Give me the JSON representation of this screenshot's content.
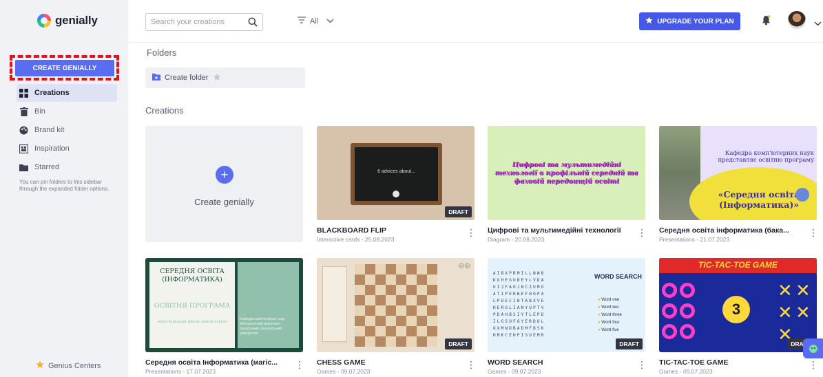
{
  "brand": {
    "name": "genially"
  },
  "sidebar": {
    "create_label": "CREATE GENIALLY",
    "items": [
      {
        "label": "Creations",
        "icon": "grid-icon"
      },
      {
        "label": "Bin",
        "icon": "trash-icon"
      },
      {
        "label": "Brand kit",
        "icon": "palette-icon"
      },
      {
        "label": "Inspiration",
        "icon": "inspiration-icon"
      },
      {
        "label": "Starred",
        "icon": "folder-icon"
      }
    ],
    "note": "You can pin folders to this sidebar through the expanded folder options.",
    "footer_label": "Genius Centers"
  },
  "topbar": {
    "search_placeholder": "Search your creations",
    "filter_label": "All",
    "upgrade_label": "UPGRADE YOUR PLAN"
  },
  "main": {
    "folders_title": "Folders",
    "create_folder_label": "Create folder",
    "creations_title": "Creations",
    "create_card_label": "Create genially",
    "draft_label": "DRAFT",
    "cards": [
      {
        "title": "BLACKBOARD FLIP",
        "meta": "Interactive cards - 25.08.2023",
        "thumb_text": "6 advices about...",
        "draft": true
      },
      {
        "title": "Цифрові та мультимедійні технології",
        "meta": "Diagram - 20.08.2023",
        "thumb_text": "Цифрові та мультимедійні технології в профільній середній та фаховій передвищій освіті",
        "draft": false
      },
      {
        "title": "Середня освіта інформатика (бака...",
        "meta": "Presentations - 21.07.2023",
        "thumb_text_1": "Кафедра комп'ютерних наук представляє освітню програму",
        "thumb_text_2": "«Середня освіта (Інформатика)»",
        "draft": false
      },
      {
        "title": "Середня освіта Інформатика (магіс...",
        "meta": "Presentations - 17.07.2023",
        "thumb_text_1": "СЕРЕДНЯ ОСВІТА (ІНФОРМАТИКА)",
        "thumb_text_2": "ОСВІТНЯ ПРОГРАМА",
        "thumb_text_3": "магістерський рівень вищої освіти",
        "thumb_text_4": "Кафедра комп'ютерних наук Математичний факультет Запорізький національний університет",
        "draft": false
      },
      {
        "title": "CHESS GAME",
        "meta": "Games - 09.07.2023",
        "draft": true
      },
      {
        "title": "WORD SEARCH",
        "meta": "Games - 09.07.2023",
        "thumb_title": "WORD SEARCH",
        "thumb_words": [
          "Word one",
          "Word two",
          "Word three",
          "Word four",
          "Word five"
        ],
        "draft": true
      },
      {
        "title": "TIC-TAC-TOE GAME",
        "meta": "Games - 09.07.2023",
        "thumb_title": "TIC-TAC-TOE GAME",
        "thumb_number": "3",
        "draft": true
      }
    ]
  },
  "colors": {
    "accent": "#5a6cf0",
    "upgrade": "#4658e8",
    "highlight": "#e8101a"
  }
}
